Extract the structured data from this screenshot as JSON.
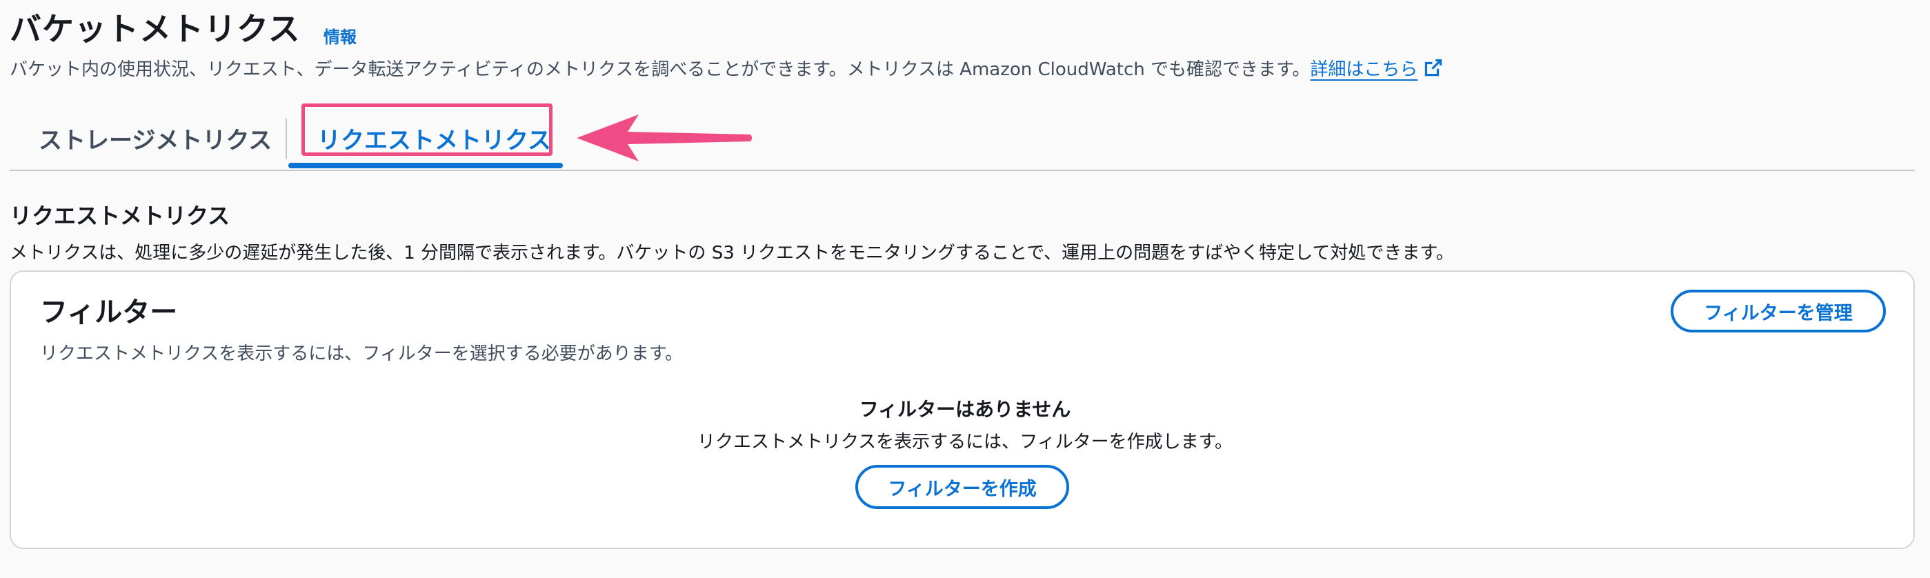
{
  "header": {
    "title": "バケットメトリクス",
    "info_link": "情報",
    "description": "バケット内の使用状況、リクエスト、データ転送アクティビティのメトリクスを調べることができます。メトリクスは Amazon CloudWatch でも確認できます。",
    "details_link": "詳細はこちら",
    "details_link_icon": "external-link-icon"
  },
  "tabs": [
    {
      "label": "ストレージメトリクス",
      "selected": false
    },
    {
      "label": "リクエストメトリクス",
      "selected": true
    }
  ],
  "annotation": {
    "highlight_color": "#ef4b84",
    "icon": "arrow-left-icon"
  },
  "section": {
    "title": "リクエストメトリクス",
    "description": "メトリクスは、処理に多少の遅延が発生した後、1 分間隔で表示されます。バケットの S3 リクエストをモニタリングすることで、運用上の問題をすばやく特定して対処できます。"
  },
  "filter_card": {
    "title": "フィルター",
    "description": "リクエストメトリクスを表示するには、フィルターを選択する必要があります。",
    "manage_button": "フィルターを管理",
    "empty_title": "フィルターはありません",
    "empty_description": "リクエストメトリクスを表示するには、フィルターを作成します。",
    "create_button": "フィルターを作成"
  },
  "colors": {
    "accent": "#0972d3",
    "text": "#16191f",
    "muted_text": "#414d5c",
    "border": "#c6c6cd",
    "background": "#fafafa"
  }
}
